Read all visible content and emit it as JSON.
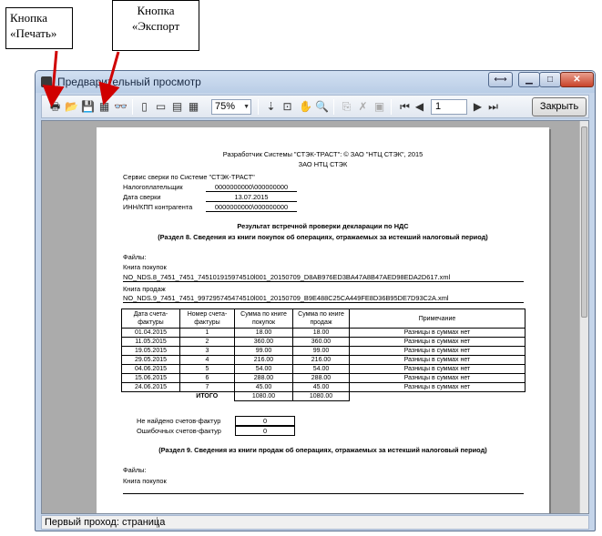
{
  "callouts": {
    "print": "Кнопка «Печать»",
    "export": "Кнопка «Экспорт"
  },
  "window": {
    "title": "Предварительный просмотр",
    "zoom": "75%",
    "page_number": "1",
    "close_label": "Закрыть",
    "status": "Первый проход: страница"
  },
  "report": {
    "developer": "Разработчик Системы \"СТЭК-ТРАСТ\": © ЗАО \"НТЦ СТЭК\", 2015",
    "org": "ЗАО НТЦ СТЭК",
    "service": "Сервис сверки по Системе \"СТЭК-ТРАСТ\"",
    "taxpayer_label": "Налогоплательщик",
    "taxpayer_value": "0000000000\\000000000",
    "date_label": "Дата сверки",
    "date_value": "13.07.2015",
    "counterparty_label": "ИНН/КПП контрагента",
    "counterparty_value": "0000000000\\000000000",
    "heading": "Результат встречной проверки декларации по НДС",
    "section8": "(Раздел 8. Сведения из книги покупок об операциях, отражаемых за истекший налоговый период)",
    "files_label": "Файлы:",
    "purchase_book_label": "Книга покупок",
    "purchase_file": "NO_NDS.8_7451_7451_745101915974510l001_20150709_D8AB976ED3BA47A8B47AED98EDA2D617.xml",
    "sales_book_label": "Книга продаж",
    "sales_file": "NO_NDS.9_7451_7451_997295745474510l001_20150709_B9E488C25CA449FE8D36B95DE7D93C2A.xml",
    "table": {
      "headers": [
        "Дата счета-фактуры",
        "Номер счета-фактуры",
        "Сумма по книге покупок",
        "Сумма по книге продаж",
        "Примечание"
      ],
      "rows": [
        [
          "01.04.2015",
          "1",
          "18.00",
          "18.00",
          "Разницы в суммах нет"
        ],
        [
          "11.05.2015",
          "2",
          "360.00",
          "360.00",
          "Разницы в суммах нет"
        ],
        [
          "19.05.2015",
          "3",
          "99.00",
          "99.00",
          "Разницы в суммах нет"
        ],
        [
          "29.05.2015",
          "4",
          "216.00",
          "216.00",
          "Разницы в суммах нет"
        ],
        [
          "04.06.2015",
          "5",
          "54.00",
          "54.00",
          "Разницы в суммах нет"
        ],
        [
          "15.06.2015",
          "6",
          "288.00",
          "288.00",
          "Разницы в суммах нет"
        ],
        [
          "24.06.2015",
          "7",
          "45.00",
          "45.00",
          "Разницы в суммах нет"
        ]
      ],
      "total_label": "ИТОГО",
      "total_purchases": "1080.00",
      "total_sales": "1080.00"
    },
    "not_found_label": "Не найдено счетов-фактур",
    "not_found_value": "0",
    "errors_label": "Ошибочных счетов-фактур",
    "errors_value": "0",
    "section9": "(Раздел 9. Сведения из книги продаж об операциях, отражаемых за истекший налоговый период)",
    "files_label2": "Файлы:",
    "purchase_book_label2": "Книга покупок"
  }
}
